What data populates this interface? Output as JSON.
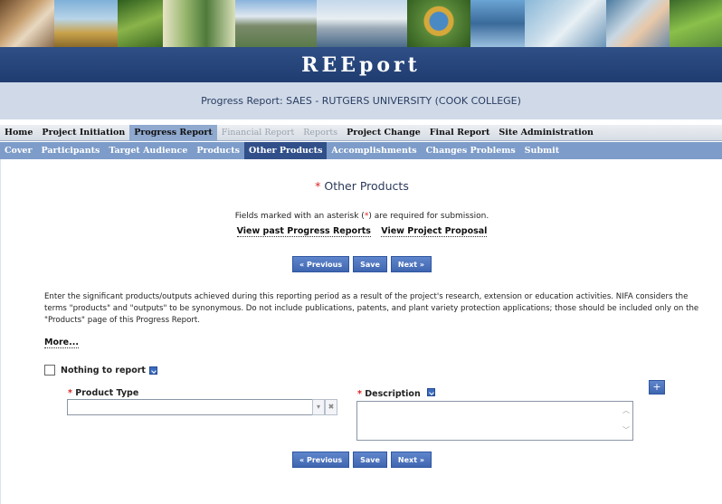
{
  "app": {
    "brand": "REEport",
    "subtitle": "Progress Report: SAES - RUTGERS UNIVERSITY (COOK COLLEGE)"
  },
  "main_nav": [
    {
      "label": "Home",
      "state": "normal"
    },
    {
      "label": "Project Initiation",
      "state": "normal"
    },
    {
      "label": "Progress Report",
      "state": "active"
    },
    {
      "label": "Financial Report",
      "state": "disabled"
    },
    {
      "label": "Reports",
      "state": "disabled"
    },
    {
      "label": "Project Change",
      "state": "normal"
    },
    {
      "label": "Final Report",
      "state": "normal"
    },
    {
      "label": "Site Administration",
      "state": "normal"
    }
  ],
  "sub_nav": [
    {
      "label": "Cover",
      "state": "normal"
    },
    {
      "label": "Participants",
      "state": "normal"
    },
    {
      "label": "Target Audience",
      "state": "normal"
    },
    {
      "label": "Products",
      "state": "normal"
    },
    {
      "label": "Other Products",
      "state": "active"
    },
    {
      "label": "Accomplishments",
      "state": "normal"
    },
    {
      "label": "Changes Problems",
      "state": "normal"
    },
    {
      "label": "Submit",
      "state": "normal"
    }
  ],
  "page": {
    "required_marker": "*",
    "heading": "Other Products",
    "required_note_before": "Fields marked with an asterisk (",
    "required_note_ast": "*",
    "required_note_after": ") are required for submission.",
    "link_past_reports": "View past Progress Reports",
    "link_proposal": "View Project Proposal",
    "intro_text": "Enter the significant products/outputs achieved during this reporting period as a result of the project's research, extension or education activities. NIFA considers the terms \"products\" and \"outputs\" to be synonymous.  Do not include publications, patents, and plant variety protection applications; those should be included only on the \"Products\" page of this Progress Report.",
    "more_link": "More...",
    "nothing_to_report_label": "Nothing to report",
    "nothing_to_report_checked": false
  },
  "buttons": {
    "previous": "« Previous",
    "save": "Save",
    "next": "Next »",
    "add": "+"
  },
  "form": {
    "product_type_label": "Product Type",
    "product_type_value": "",
    "description_label": "Description",
    "description_value": "",
    "combo_dropdown_glyph": "▾",
    "combo_clear_glyph": "✖",
    "scroll_up_glyph": "︿",
    "scroll_down_glyph": "﹀"
  },
  "colors": {
    "title_bar": "#1f3c70",
    "active_main_tab": "#8fa9cf",
    "sub_nav_bg": "#7d9cc9",
    "active_sub_tab": "#31508a",
    "button_blue": "#3f66b0",
    "required_red": "#dd2222"
  }
}
